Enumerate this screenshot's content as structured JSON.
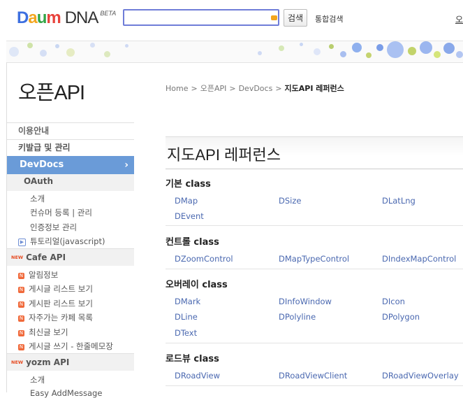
{
  "header": {
    "logo_daum": "Daum",
    "logo_dna": "DNA",
    "logo_beta": "BETA",
    "search_value": "",
    "search_button": "검색",
    "total_search": "통합검색",
    "right_edge": "오"
  },
  "sidebar": {
    "title": "오픈API",
    "intro": "이용안내",
    "key_manage": "키발급 및 관리",
    "devdocs": "DevDocs",
    "oauth": "OAuth",
    "oauth_items": [
      "소개",
      "컨슈머 등록 | 관리",
      "인증정보 관리"
    ],
    "tutorial": "튜토리얼(javascript)",
    "cafe_new": "NEW",
    "cafe_api": "Cafe API",
    "cafe_items": [
      "알림정보",
      "게시글 리스트 보기",
      "게시판 리스트 보기",
      "자주가는 카페 목록",
      "최신글 보기",
      "게시글 쓰기 - 한줄메모장"
    ],
    "yozm_new": "NEW",
    "yozm_api": "yozm API",
    "yozm_items": [
      "소개",
      "Easy AddMessage"
    ]
  },
  "breadcrumb": {
    "home": "Home",
    "open_api": "오픈API",
    "devdocs": "DevDocs",
    "current": "지도API 레퍼런스",
    "separator": ">"
  },
  "reference": {
    "title": "지도API 레퍼런스",
    "sections": [
      {
        "title": "기본 class",
        "rows": [
          [
            "DMap",
            "DSize",
            "DLatLng"
          ],
          [
            "DEvent"
          ]
        ]
      },
      {
        "title": "컨트롤 class",
        "rows": [
          [
            "DZoomControl",
            "DMapTypeControl",
            "DIndexMapControl"
          ]
        ]
      },
      {
        "title": "오버레이 class",
        "rows": [
          [
            "DMark",
            "DInfoWindow",
            "DIcon"
          ],
          [
            "DLine",
            "DPolyline",
            "DPolygon"
          ],
          [
            "DText"
          ]
        ]
      },
      {
        "title": "로드뷰 class",
        "rows": [
          [
            "DRoadView",
            "DRoadViewClient",
            "DRoadViewOverlay"
          ]
        ]
      }
    ]
  },
  "colors": {
    "accent": "#6a9bd8",
    "link": "#4a68b0",
    "search_border": "#6f7dd8",
    "new_badge": "#e64a20"
  }
}
